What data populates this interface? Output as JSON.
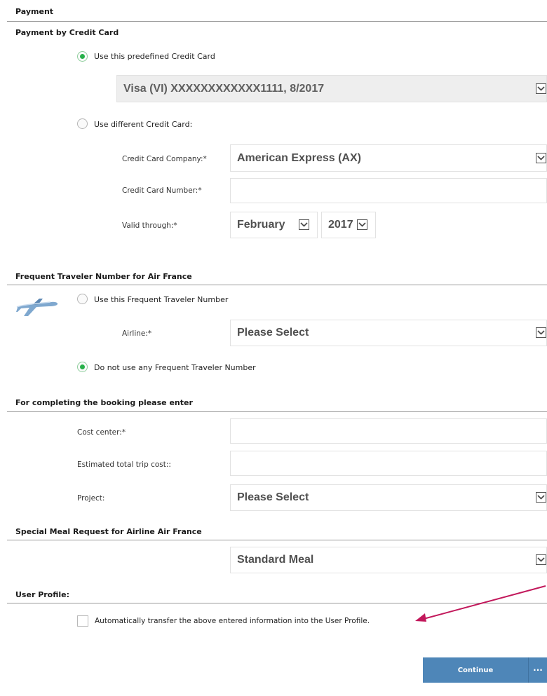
{
  "payment": {
    "title": "Payment",
    "credit_card_section": {
      "title": "Payment by Credit Card",
      "use_predefined_label": "Use this predefined Credit Card",
      "predefined_card_value": "Visa (VI) XXXXXXXXXXXX1111, 8/2017",
      "use_different_label": "Use different Credit Card:",
      "company_label": "Credit Card Company:*",
      "company_value": "American Express (AX)",
      "number_label": "Credit Card Number:*",
      "number_value": "",
      "valid_label": "Valid through:*",
      "valid_month": "February",
      "valid_year": "2017"
    },
    "frequent_traveler": {
      "title": "Frequent Traveler Number for Air France",
      "use_number_label": "Use this Frequent Traveler Number",
      "airline_label": "Airline:*",
      "airline_value": "Please Select",
      "no_number_label": "Do not use any Frequent Traveler Number",
      "icon": "airplane-icon"
    },
    "completion": {
      "title": "For completing the booking please enter",
      "cost_center_label": "Cost center:*",
      "cost_center_value": "",
      "estimated_cost_label": "Estimated total trip cost::",
      "estimated_cost_value": "",
      "project_label": "Project:",
      "project_value": "Please Select"
    },
    "meal": {
      "title": "Special Meal Request for Airline Air France",
      "meal_value": "Standard Meal"
    },
    "user_profile": {
      "title": "User Profile:",
      "transfer_label": "Automatically transfer the above entered information into the User Profile."
    },
    "actions": {
      "continue_label": "Continue",
      "more_label": "···"
    },
    "colors": {
      "radio_checked": "#27b04a",
      "button_bg": "#4e86b8",
      "annotation_arrow": "#c2185b"
    }
  }
}
